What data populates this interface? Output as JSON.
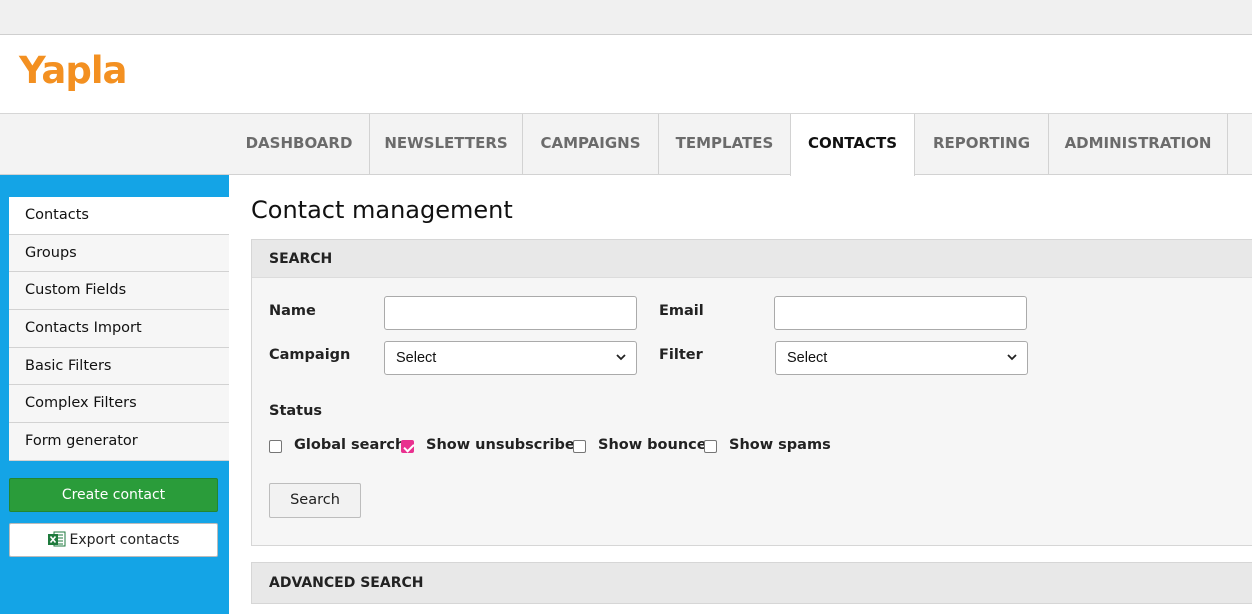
{
  "brand": {
    "logo_text": "Yapla",
    "logo_color": "#f39021"
  },
  "nav": {
    "tabs": [
      {
        "label": "DASHBOARD",
        "active": false
      },
      {
        "label": "NEWSLETTERS",
        "active": false
      },
      {
        "label": "CAMPAIGNS",
        "active": false
      },
      {
        "label": "TEMPLATES",
        "active": false
      },
      {
        "label": "CONTACTS",
        "active": true
      },
      {
        "label": "REPORTING",
        "active": false
      },
      {
        "label": "ADMINISTRATION",
        "active": false
      }
    ]
  },
  "sidebar": {
    "accent_color": "#14a4e6",
    "items": [
      {
        "label": "Contacts",
        "active": true
      },
      {
        "label": "Groups"
      },
      {
        "label": "Custom Fields"
      },
      {
        "label": "Contacts Import"
      },
      {
        "label": "Basic Filters"
      },
      {
        "label": "Complex Filters"
      },
      {
        "label": "Form generator"
      }
    ],
    "create_button": "Create contact",
    "export_button": "Export contacts",
    "export_icon": "excel-icon"
  },
  "main": {
    "title": "Contact management",
    "search_panel": {
      "header": "SEARCH",
      "name_label": "Name",
      "name_value": "",
      "email_label": "Email",
      "email_value": "",
      "campaign_label": "Campaign",
      "campaign_selected": "Select",
      "filter_label": "Filter",
      "filter_selected": "Select",
      "status_label": "Status",
      "checkboxes": [
        {
          "label": "Global search",
          "checked": false
        },
        {
          "label": "Show unsubscriber",
          "checked": true
        },
        {
          "label": "Show bounce",
          "checked": false
        },
        {
          "label": "Show spams",
          "checked": false
        }
      ],
      "search_button": "Search"
    },
    "advanced_search": {
      "header": "ADVANCED SEARCH"
    }
  }
}
